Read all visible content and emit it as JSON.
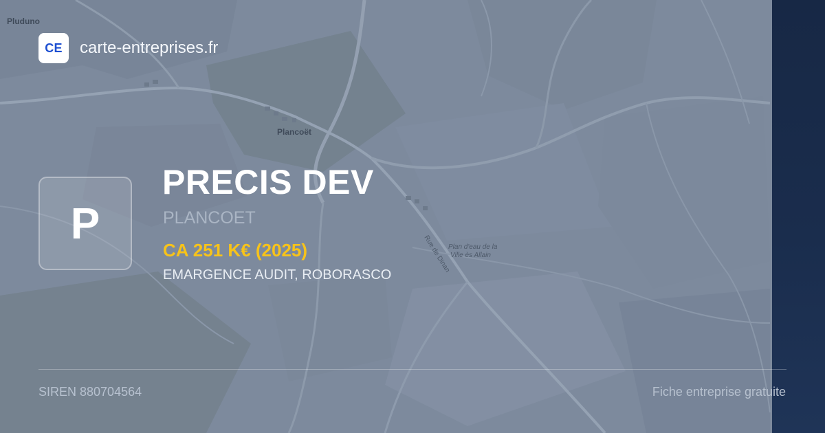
{
  "brand": {
    "logo_text": "CE",
    "domain": "carte-entreprises.fr",
    "logo_color": "#1d4fd1"
  },
  "company": {
    "initial": "P",
    "name": "PRECIS DEV",
    "city": "PLANCOET",
    "revenue": "CA 251 K€ (2025)",
    "aliases": "EMARGENCE AUDIT, ROBORASCO"
  },
  "footer": {
    "siren": "SIREN 880704564",
    "tagline": "Fiche entreprise gratuite"
  },
  "map": {
    "places": [
      "Pluduno",
      "Plancoët",
      "Rue de Dinan",
      "Plan d'eau de la",
      "Ville ès Allain"
    ]
  },
  "colors": {
    "revenue": "#f7c31a",
    "right_band": "#172845",
    "text_primary": "#ffffff",
    "text_muted": "#b7c1cf"
  },
  "icons": {
    "logo": "ce-logo-icon",
    "avatar": "company-initial-avatar"
  }
}
